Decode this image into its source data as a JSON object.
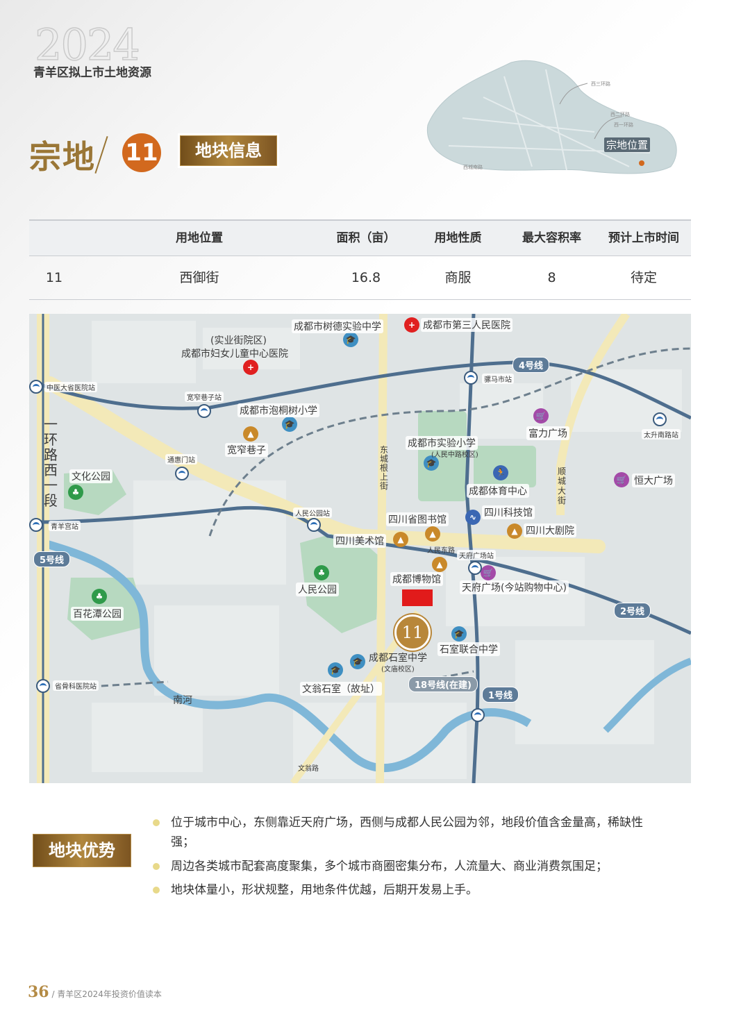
{
  "header": {
    "year": "2024",
    "subtitle": "青羊区拟上市土地资源",
    "plot_word": "宗地",
    "plot_number": "11",
    "section_badge": "地块信息",
    "minimap_label": "宗地位置"
  },
  "table": {
    "headers": [
      "",
      "用地位置",
      "面积（亩）",
      "用地性质",
      "最大容积率",
      "预计上市时间"
    ],
    "row": [
      "11",
      "西御街",
      "16.8",
      "商服",
      "8",
      "待定"
    ]
  },
  "map": {
    "labels": {
      "shude": "成都市树德实验中学",
      "hospital3": "成都市第三人民医院",
      "shiyejie": "(实业街院区)",
      "fuer": "成都市妇女儿童中心医院",
      "line4": "4号线",
      "jiangma": "骡马市站",
      "zhongyi": "中医大省医院站",
      "kuanzhai_st": "宽窄巷子站",
      "paotong": "成都市泡桐树小学",
      "kuanzhai": "宽窄巷子",
      "fuli": "富力广场",
      "taisheng": "太升南路站",
      "ring": "一环路西一段",
      "wenhua": "文化公园",
      "tonghui": "通惠门站",
      "shiyan": "成都市实验小学",
      "shiyan_sub": "(人民中路校区)",
      "dongcheng": "东城根上街",
      "shuncheng": "顺城大街",
      "hengda": "恒大广场",
      "tiyu": "成都体育中心",
      "qingyang_st": "青羊宫站",
      "renmin_st": "人民公园站",
      "library": "四川省图书馆",
      "keji": "四川科技馆",
      "dajuyuan": "四川大剧院",
      "meishu": "四川美术馆",
      "renmindong": "人民东路",
      "line5": "5号线",
      "tianfu_st": "天府广场站",
      "museum": "成都博物馆",
      "tianfu": "天府广场(今站购物中心)",
      "renmin_park": "人民公园",
      "baihuatan": "百花潭公园",
      "line2": "2号线",
      "plot": "11",
      "shishi_lianhe": "石室联合中学",
      "shishi": "成都石室中学",
      "wenmiao": "(文庙校区)",
      "line18": "18号线(在建)",
      "guke": "省骨科医院站",
      "wenweng": "文翁石室（故址）",
      "line1": "1号线",
      "nanhe": "南河",
      "wenmiao_rd": "文翁路"
    },
    "minimap_roads": [
      "西三环路",
      "西二环路",
      "西一环路",
      "西城南路"
    ]
  },
  "advantages": {
    "badge": "地块优势",
    "items": [
      "位于城市中心，东侧靠近天府广场，西侧与成都人民公园为邻，地段价值含金量高，稀缺性强；",
      "周边各类城市配套高度聚集，多个城市商圈密集分布，人流量大、商业消费氛围足；",
      "地块体量小，形状规整，用地条件优越，后期开发易上手。"
    ]
  },
  "footer": {
    "page": "36",
    "text": "/ 青羊区2024年投资价值读本"
  }
}
